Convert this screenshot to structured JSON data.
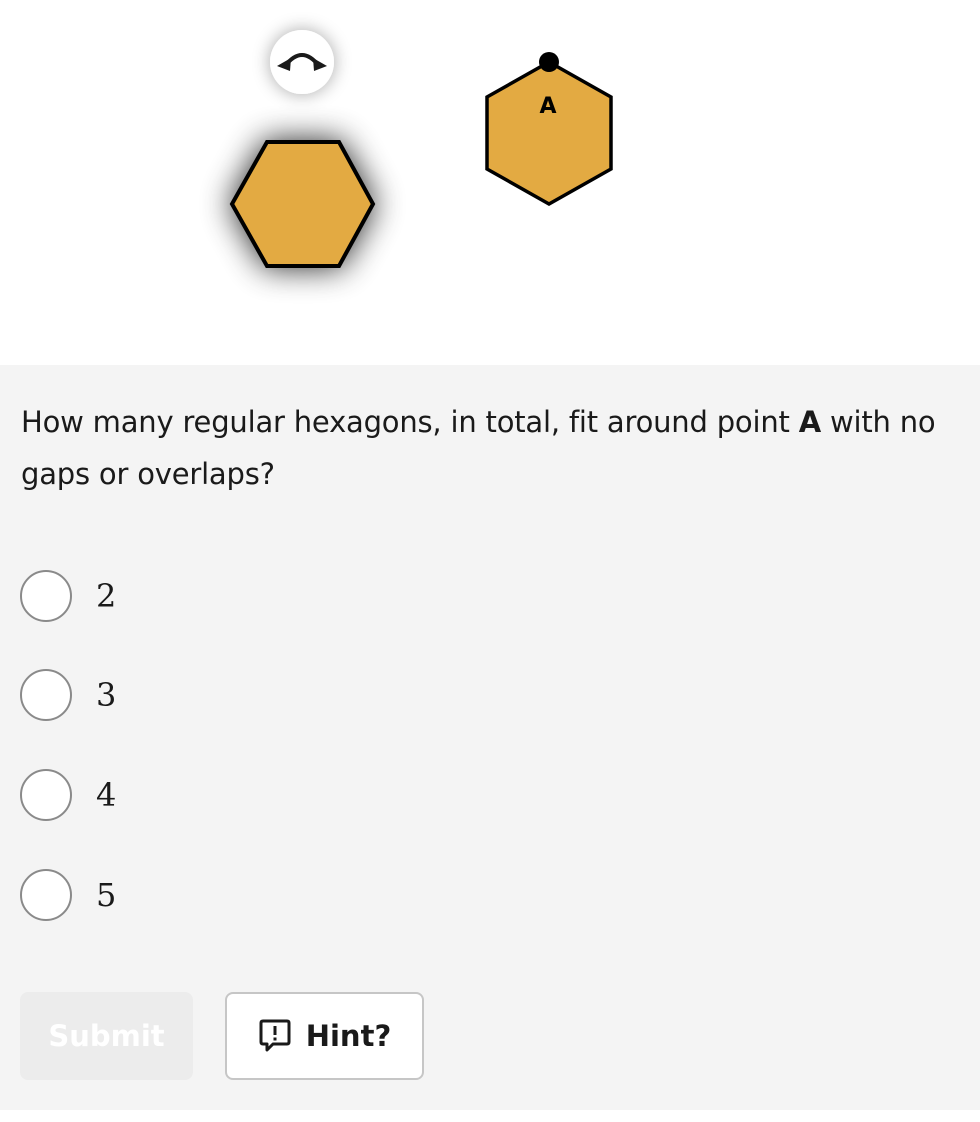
{
  "diagram": {
    "point_label": "A",
    "hexagon_fill": "#e3aa42",
    "hexagon_stroke": "#000000",
    "rotate_handle_icon": "rotate-arrows-icon"
  },
  "question": {
    "text_before": "How many regular hexagons, in total, fit around point ",
    "point": "A",
    "text_after": " with no gaps or overlaps?"
  },
  "choices": [
    {
      "label": "2"
    },
    {
      "label": "3"
    },
    {
      "label": "4"
    },
    {
      "label": "5"
    }
  ],
  "buttons": {
    "submit_label": "Submit",
    "hint_label": "Hint?",
    "hint_icon": "speech-bubble-exclamation-icon"
  },
  "colors": {
    "panel_background": "#f4f4f4",
    "hexagon": "#e3aa42",
    "radio_border": "#8a8a8a",
    "submit_disabled_bg": "#ececec"
  }
}
